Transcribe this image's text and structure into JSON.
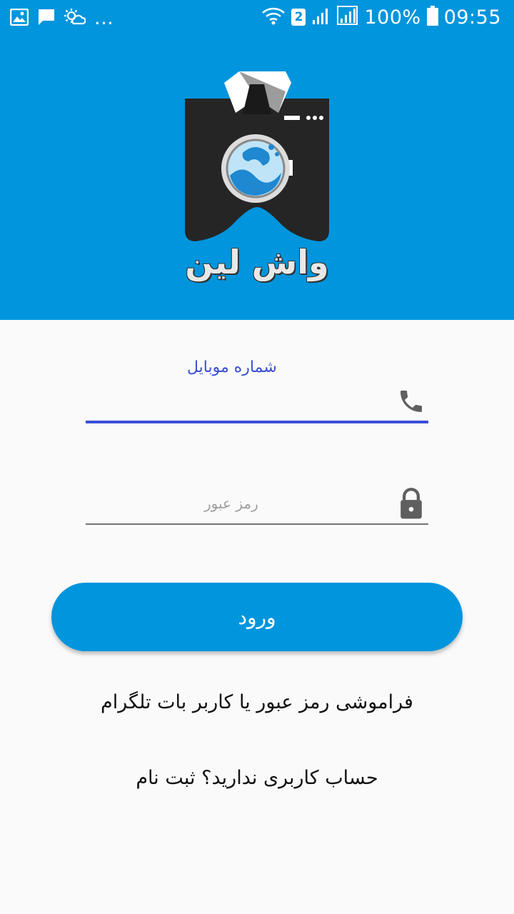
{
  "status_bar": {
    "battery_percent": "100%",
    "time": "09:55",
    "overflow": "...",
    "sim_badge": "2"
  },
  "app": {
    "logo_text": "واش لین"
  },
  "form": {
    "mobile_label": "شماره موبایل",
    "password_placeholder": "رمز عبور",
    "login_label": "ورود",
    "forgot_text": "فراموشی رمز عبور یا کاربر بات تلگرام",
    "signup_text": "حساب کاربری ندارید؟ ثبت نام"
  },
  "colors": {
    "primary": "#0095dd",
    "accent": "#3b4fd6",
    "background": "#fafafa"
  }
}
